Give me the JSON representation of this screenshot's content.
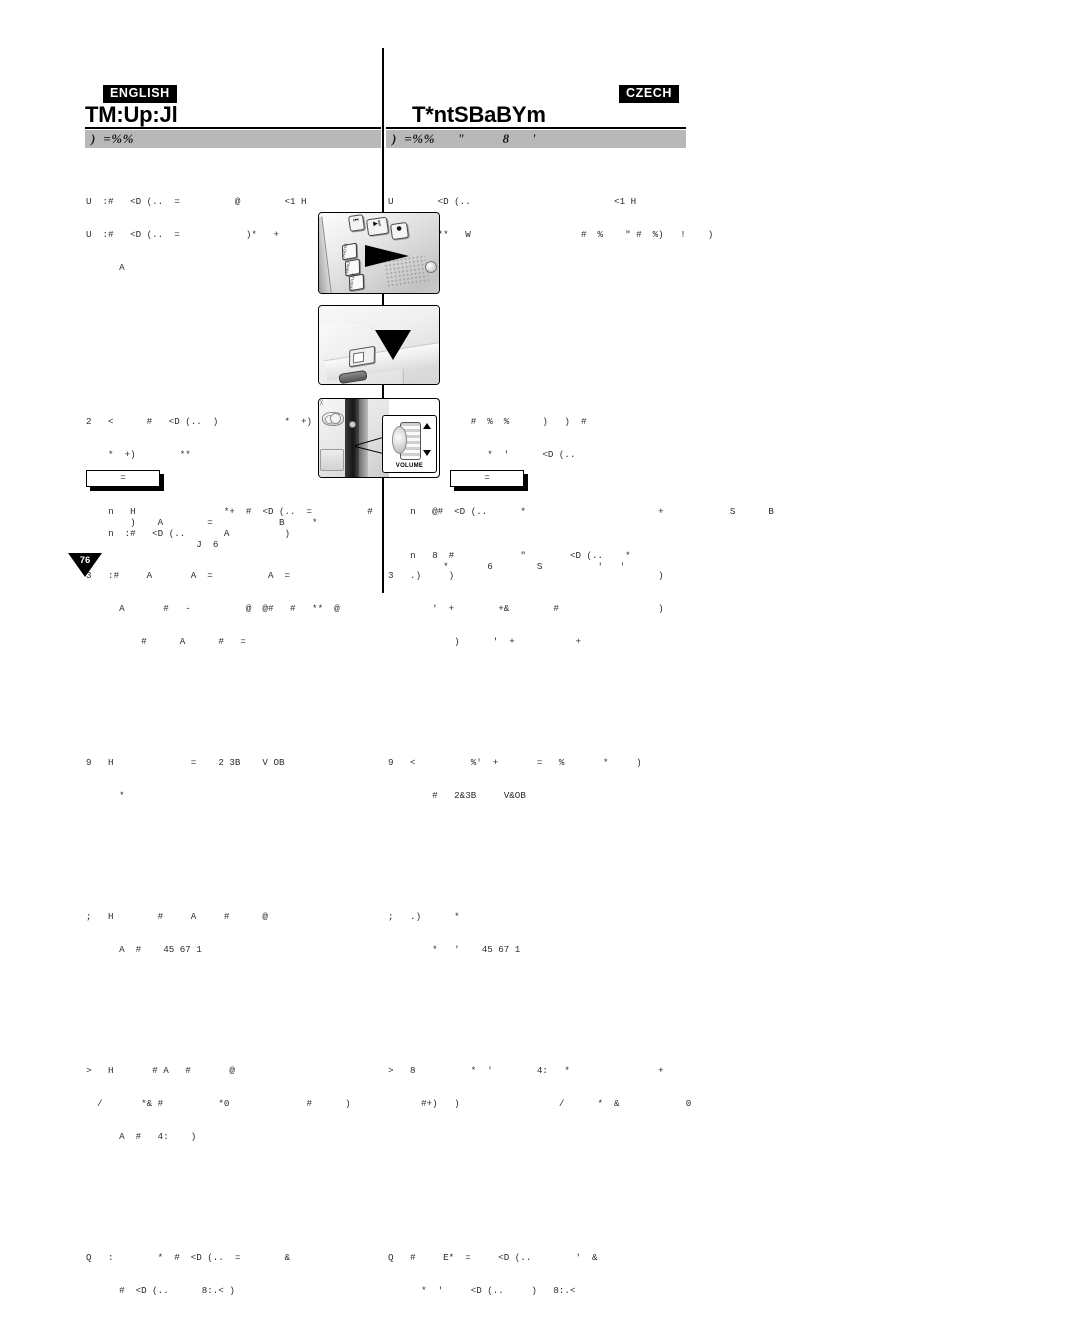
{
  "document": {
    "page_number": "76",
    "kind": "bilingual-camcorder-manual-page"
  },
  "english": {
    "badge": "ENGLISH",
    "title": "TM:Up:Jl",
    "grey_bar": ")  =%%",
    "intro": [
      "U  :#   <D (..  =          @        <1 H",
      "U  :#   <D (..  =            )*   +       A  =+  *  +)",
      "      A"
    ],
    "steps": [
      [
        "2   <      #   <D (..  )            *  +)",
        "    *  +)        **"
      ],
      [
        "3   :#     A       A  =          A  =",
        "      A       #   -          @  @#   #   **  @",
        "          #      A      #   ="
      ],
      [
        "9   H              =    2 3B    V OB",
        "      *"
      ],
      [
        ";   H        #     A     #      @",
        "      A  #    45 67 1"
      ],
      [
        ">   H       # A   #       @",
        "  /       *& #          *0              #      )",
        "      A  #   4:    )"
      ],
      [
        "Q   :        *  #  <D (..  =        &",
        "      #  <D (..      8:.< )"
      ]
    ],
    "notes_label": "=",
    "notes": [
      "n   H                *+  #  <D (..  =          #",
      "    )    A        =            B     *",
      "n  :#   <D (..       A          )",
      "                J  6"
    ]
  },
  "czech": {
    "badge": "CZECH",
    "title": "T*ntSBaBYm",
    "grey_bar": ")  =%%      \"          8      '",
    "intro": [
      "U        <D (..                          <1 H",
      "U        **   W                    #  %    \" #  %)   !    )"
    ],
    "steps": [
      [
        "2   D #        #  %  %      )   )  #",
        "                  *  '      <D (.."
      ],
      [
        "3   .)     )                                     )",
        "        '  +        +&        #                  )",
        "            )      '  +           +"
      ],
      [
        "9   <          %'  +       =   %       *     )",
        "        #   2&3B     V&OB"
      ],
      [
        ";   .)      *",
        "        *   '    45 67 1"
      ],
      [
        ">   8          *  '        4:   *                +",
        "      #+)   )                  /      *  &            0"
      ],
      [
        "Q   #     E*  =     <D (..        '  &",
        "      *  '     <D (..     )   8:.<"
      ]
    ],
    "notes_label": "=",
    "notes": [
      "n   @#  <D (..      *                        +            S      B",
      "n   8  #            \"        <D (..    *",
      "      *       6        S          '   '"
    ]
  },
  "figures": [
    {
      "name": "rear-control-panel",
      "buttons": [
        "⏮",
        "▶‖",
        "●"
      ],
      "side_labels": [
        "PHOTO",
        "MENU",
        "DISPLAY"
      ],
      "annotation": "arrow-pointing-left"
    },
    {
      "name": "top-power-slider",
      "annotation": "arrow-pointing-down-left"
    },
    {
      "name": "side-volume-dial",
      "callout_label": "VOLUME",
      "callout_marks": [
        "▲",
        "▼"
      ]
    }
  ]
}
